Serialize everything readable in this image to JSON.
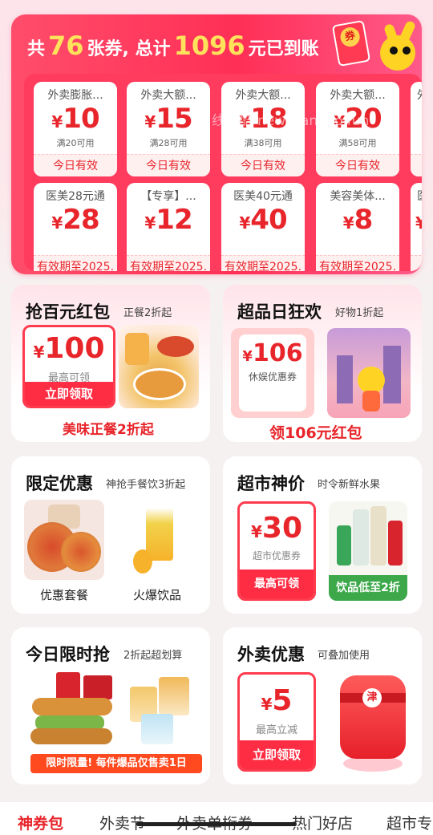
{
  "banner": {
    "prefix": "共",
    "count": "76",
    "mid": "张券, 总计",
    "total": "1096",
    "suffix": "元已到账",
    "envelope_char": "券",
    "watermark": "线报酷-new.xianbao.fun"
  },
  "coupons": [
    {
      "title": "外卖膨胀...",
      "currency": "¥",
      "amount": "10",
      "condition": "满20可用",
      "validity": "今日有效"
    },
    {
      "title": "外卖大额...",
      "currency": "¥",
      "amount": "15",
      "condition": "满28可用",
      "validity": "今日有效"
    },
    {
      "title": "外卖大额...",
      "currency": "¥",
      "amount": "18",
      "condition": "满38可用",
      "validity": "今日有效"
    },
    {
      "title": "外卖大额...",
      "currency": "¥",
      "amount": "20",
      "condition": "满58可用",
      "validity": "今日有效"
    },
    {
      "title": "外",
      "currency": "",
      "amount": "",
      "condition": "",
      "validity": ""
    },
    {
      "title": "医美28元通",
      "currency": "¥",
      "amount": "28",
      "condition": "",
      "validity": "有效期至2025."
    },
    {
      "title": "【专享】...",
      "currency": "¥",
      "amount": "12",
      "condition": "",
      "validity": "有效期至2025."
    },
    {
      "title": "医美40元通",
      "currency": "¥",
      "amount": "40",
      "condition": "",
      "validity": "有效期至2025."
    },
    {
      "title": "美容美体...",
      "currency": "¥",
      "amount": "8",
      "condition": "",
      "validity": "有效期至2025."
    },
    {
      "title": "医",
      "currency": "¥",
      "amount": "",
      "condition": "",
      "validity": ""
    }
  ],
  "cards": {
    "hongbao": {
      "title": "抢百元红包",
      "subtitle": "正餐2折起",
      "currency": "¥",
      "amount": "100",
      "label": "最高可领",
      "button": "立即领取",
      "caption": "美味正餐2折起"
    },
    "carnival": {
      "title": "超品日狂欢",
      "subtitle": "好物1折起",
      "currency": "¥",
      "amount": "106",
      "label": "休娱优惠券",
      "caption": "领106元红包"
    },
    "limited": {
      "title": "限定优惠",
      "subtitle": "神抢手餐饮3折起",
      "item1": "优惠套餐",
      "item2": "火爆饮品"
    },
    "market": {
      "title": "超市神价",
      "subtitle": "时令新鲜水果",
      "currency": "¥",
      "amount": "30",
      "label": "超市优惠券",
      "button": "最高可领",
      "drink_badge": "饮品低至2折"
    },
    "flash": {
      "title": "今日限时抢",
      "subtitle": "2折起超划算",
      "banner": "限时限量! 每件爆品仅售卖1日"
    },
    "waimai": {
      "title": "外卖优惠",
      "subtitle": "可叠加使用",
      "currency": "¥",
      "amount": "5",
      "label": "最高立减",
      "button": "立即领取",
      "gift_char": "津"
    }
  },
  "tabs": [
    "神券包",
    "外卖节",
    "外卖单桁券",
    "热门好店",
    "超市专"
  ],
  "colors": {
    "accent": "#e8252b",
    "banner": "#ff3b5e",
    "gold": "#ffe25c"
  }
}
